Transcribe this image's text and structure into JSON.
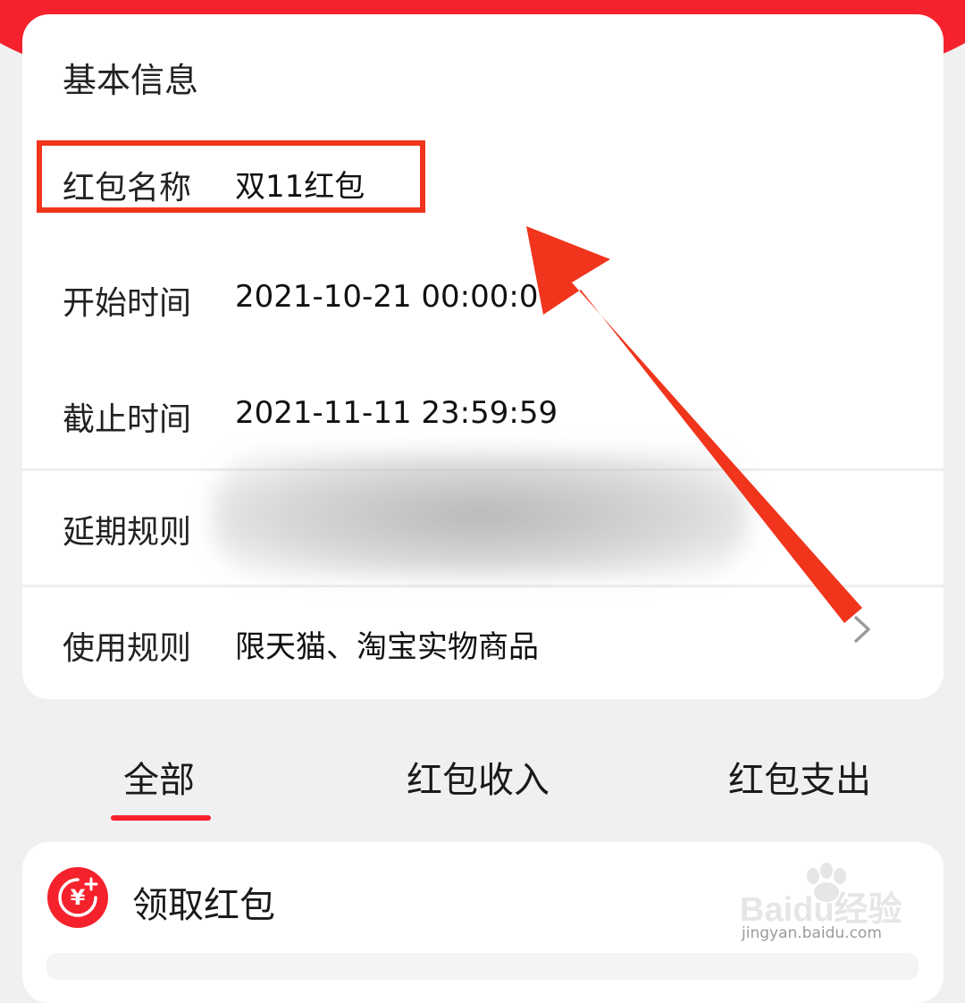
{
  "colors": {
    "accent": "#f5222d",
    "annotation": "#f0351c",
    "background": "#f0f0f0"
  },
  "info_card": {
    "title": "基本信息",
    "rows": [
      {
        "label": "红包名称",
        "value": "双11红包"
      },
      {
        "label": "开始时间",
        "value": "2021-10-21 00:00:00"
      },
      {
        "label": "截止时间",
        "value": "2021-11-11 23:59:59"
      },
      {
        "label": "延期规则",
        "value": ""
      },
      {
        "label": "使用规则",
        "value": "限天猫、淘宝实物商品"
      }
    ]
  },
  "tabs": [
    {
      "label": "全部",
      "active": true
    },
    {
      "label": "红包收入",
      "active": false
    },
    {
      "label": "红包支出",
      "active": false
    }
  ],
  "list": {
    "first_item": {
      "title": "领取红包",
      "icon": "yuan-coin-icon"
    }
  },
  "watermark": {
    "brand": "Baidu经验",
    "url": "jingyan.baidu.com"
  }
}
